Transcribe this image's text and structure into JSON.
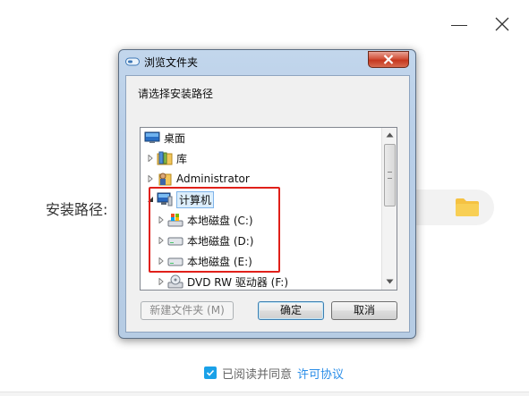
{
  "installer": {
    "install_path_label": "安装路径:",
    "agree_text": "已阅读并同意",
    "license_link": "许可协议",
    "agree_checked": true
  },
  "dialog": {
    "title": "浏览文件夹",
    "prompt": "请选择安装路径",
    "tree": [
      {
        "label": "桌面",
        "icon": "desktop-icon",
        "expander": false
      },
      {
        "label": "库",
        "icon": "library-icon",
        "expander": true
      },
      {
        "label": "Administrator",
        "icon": "user-folder-icon",
        "expander": true
      },
      {
        "label": "计算机",
        "icon": "computer-icon",
        "expander": "open",
        "selected": true
      },
      {
        "label": "本地磁盘 (C:)",
        "icon": "system-drive-icon",
        "expander": true
      },
      {
        "label": "本地磁盘 (D:)",
        "icon": "drive-icon",
        "expander": true
      },
      {
        "label": "本地磁盘 (E:)",
        "icon": "drive-icon",
        "expander": true
      },
      {
        "label": "DVD RW 驱动器 (F:)",
        "icon": "dvd-drive-icon",
        "expander": true
      }
    ],
    "buttons": {
      "new_folder": "新建文件夹 (M)",
      "ok": "确定",
      "cancel": "取消"
    }
  },
  "colors": {
    "highlight": "#e0201a",
    "link": "#2b8ee8",
    "checkbox": "#1aa1e8",
    "folder": "#f5c242"
  }
}
